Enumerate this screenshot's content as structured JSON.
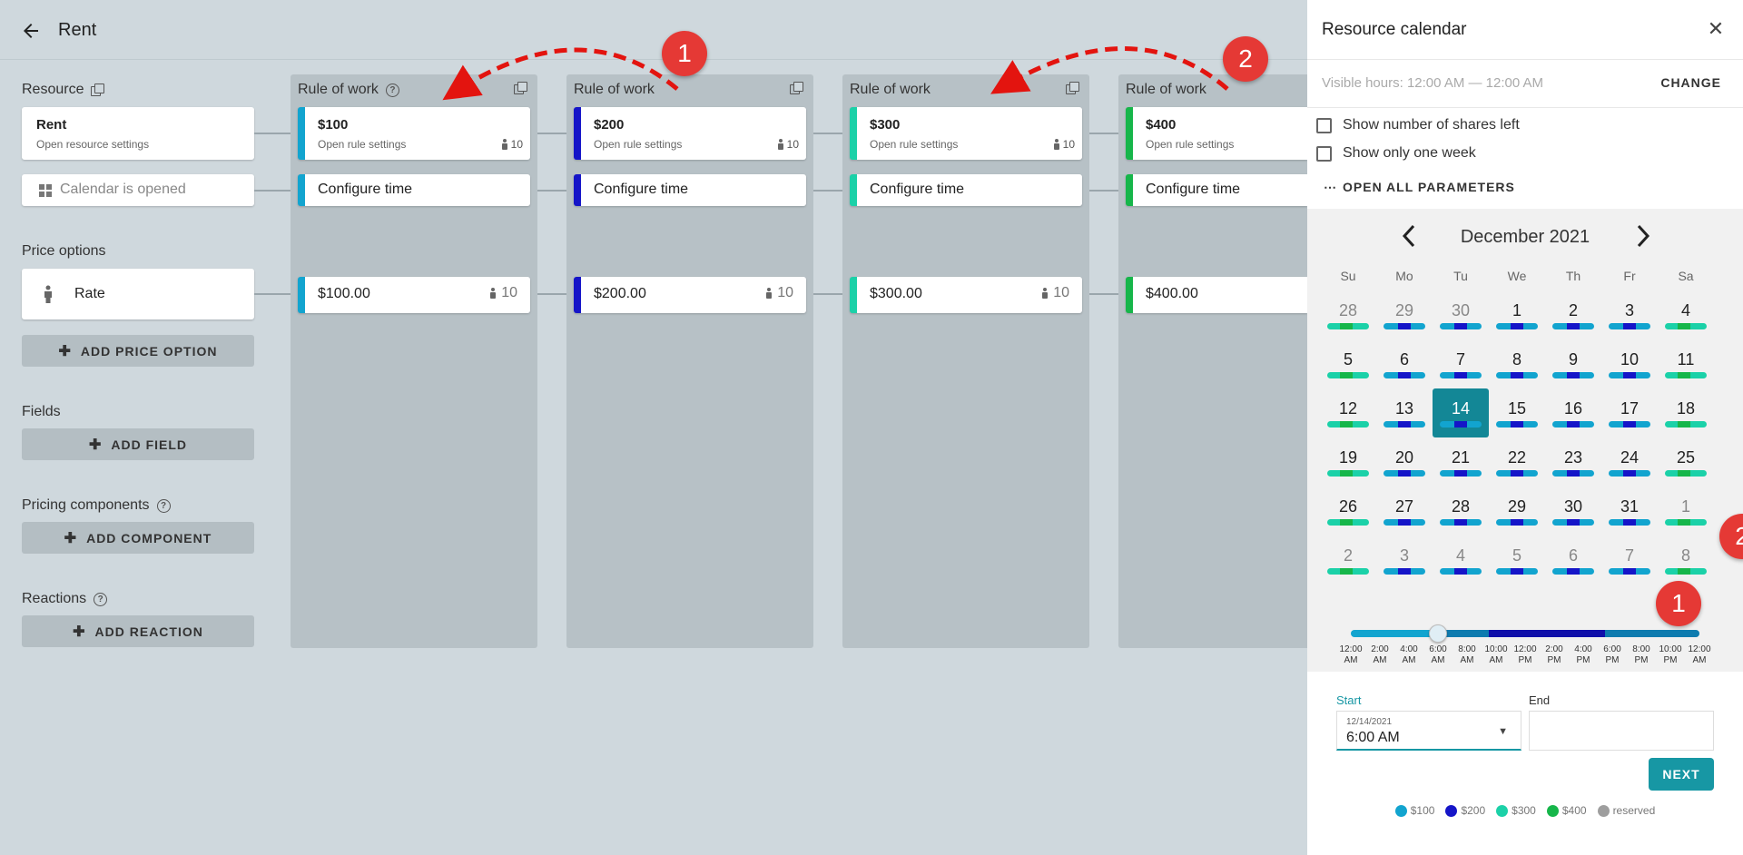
{
  "header": {
    "title": "Rent"
  },
  "sections": {
    "resource": "Resource",
    "price_options": "Price options",
    "fields": "Fields",
    "pricing_components": "Pricing components",
    "reactions": "Reactions"
  },
  "resource_card": {
    "title": "Rent",
    "subtitle": "Open resource settings"
  },
  "calendar_card": {
    "label": "Calendar is opened"
  },
  "rate_card": {
    "label": "Rate"
  },
  "buttons": {
    "add_price_option": "ADD PRICE OPTION",
    "add_field": "ADD FIELD",
    "add_component": "ADD COMPONENT",
    "add_reaction": "ADD REACTION"
  },
  "columns": [
    {
      "header": "Rule of work",
      "title": "$100",
      "subtitle": "Open rule settings",
      "count": "10",
      "configure": "Configure time",
      "price": "$100.00",
      "price_count": "10",
      "color": "#12a4cf"
    },
    {
      "header": "Rule of work",
      "title": "$200",
      "subtitle": "Open rule settings",
      "count": "10",
      "configure": "Configure time",
      "price": "$200.00",
      "price_count": "10",
      "color": "#1515c8"
    },
    {
      "header": "Rule of work",
      "title": "$300",
      "subtitle": "Open rule settings",
      "count": "10",
      "configure": "Configure time",
      "price": "$300.00",
      "price_count": "10",
      "color": "#1bd1a8"
    },
    {
      "header": "Rule of work",
      "title": "$400",
      "subtitle": "Open rule settings",
      "count": "",
      "configure": "Configure time",
      "price": "$400.00",
      "price_count": "",
      "color": "#16b64a"
    }
  ],
  "markers": {
    "m1": "1",
    "m2": "2"
  },
  "panel": {
    "title": "Resource calendar",
    "visible_hours": "Visible hours: 12:00 AM — 12:00 AM",
    "change": "CHANGE",
    "show_shares": "Show number of shares left",
    "show_week": "Show only one week",
    "open_all": "OPEN ALL PARAMETERS",
    "month": "December 2021",
    "weekdays": [
      "Su",
      "Mo",
      "Tu",
      "We",
      "Th",
      "Fr",
      "Sa"
    ],
    "days": [
      [
        "28",
        "29",
        "30",
        "1",
        "2",
        "3",
        "4"
      ],
      [
        "5",
        "6",
        "7",
        "8",
        "9",
        "10",
        "11"
      ],
      [
        "12",
        "13",
        "14",
        "15",
        "16",
        "17",
        "18"
      ],
      [
        "19",
        "20",
        "21",
        "22",
        "23",
        "24",
        "25"
      ],
      [
        "26",
        "27",
        "28",
        "29",
        "30",
        "31",
        "1"
      ],
      [
        "2",
        "3",
        "4",
        "5",
        "6",
        "7",
        "8"
      ]
    ],
    "selected_day": "14",
    "hour_ticks": [
      [
        "12:00",
        "AM"
      ],
      [
        "2:00",
        "AM"
      ],
      [
        "4:00",
        "AM"
      ],
      [
        "6:00",
        "AM"
      ],
      [
        "8:00",
        "AM"
      ],
      [
        "10:00",
        "AM"
      ],
      [
        "12:00",
        "PM"
      ],
      [
        "2:00",
        "PM"
      ],
      [
        "4:00",
        "PM"
      ],
      [
        "6:00",
        "PM"
      ],
      [
        "8:00",
        "PM"
      ],
      [
        "10:00",
        "PM"
      ],
      [
        "12:00",
        "AM"
      ]
    ],
    "start_label": "Start",
    "end_label": "End",
    "start_date": "12/14/2021",
    "start_time": "6:00 AM",
    "end_value": "",
    "next": "NEXT",
    "legend": [
      {
        "label": "$100",
        "color": "#12a4cf"
      },
      {
        "label": "$200",
        "color": "#1515c8"
      },
      {
        "label": "$300",
        "color": "#1bd1a8"
      },
      {
        "label": "$400",
        "color": "#16b64a"
      },
      {
        "label": "reserved",
        "color": "#9e9e9e"
      }
    ]
  }
}
